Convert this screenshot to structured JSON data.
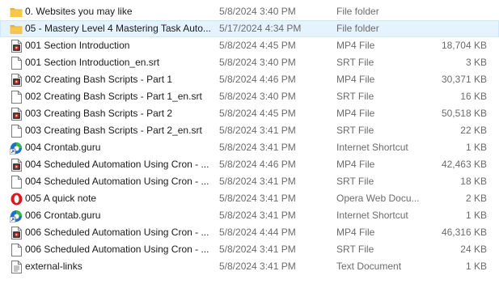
{
  "colors": {
    "selected_bg": "#e5f3ff",
    "folder": "#f5c74a",
    "media_icon_red": "#d42a1e",
    "edge_blue": "#1f6fd0",
    "edge_green": "#39b54a",
    "opera_red": "#e4141b"
  },
  "files": [
    {
      "name": "0. Websites you may like",
      "date": "5/8/2024 3:40 PM",
      "type": "File folder",
      "size": "",
      "icon": "folder-icon",
      "selected": false
    },
    {
      "name": "05 - Mastery Level 4 Mastering Task Auto...",
      "date": "5/17/2024 4:34 PM",
      "type": "File folder",
      "size": "",
      "icon": "folder-icon",
      "selected": true
    },
    {
      "name": "001 Section Introduction",
      "date": "5/8/2024 4:45 PM",
      "type": "MP4 File",
      "size": "18,704 KB",
      "icon": "video-file-icon",
      "selected": false
    },
    {
      "name": "001 Section Introduction_en.srt",
      "date": "5/8/2024 3:40 PM",
      "type": "SRT File",
      "size": "3 KB",
      "icon": "document-icon",
      "selected": false
    },
    {
      "name": "002 Creating Bash Scripts - Part 1",
      "date": "5/8/2024 4:46 PM",
      "type": "MP4 File",
      "size": "30,371 KB",
      "icon": "video-file-icon",
      "selected": false
    },
    {
      "name": "002 Creating Bash Scripts - Part 1_en.srt",
      "date": "5/8/2024 3:40 PM",
      "type": "SRT File",
      "size": "16 KB",
      "icon": "document-icon",
      "selected": false
    },
    {
      "name": "003 Creating Bash Scripts - Part 2",
      "date": "5/8/2024 4:45 PM",
      "type": "MP4 File",
      "size": "50,518 KB",
      "icon": "video-file-icon",
      "selected": false
    },
    {
      "name": "003 Creating Bash Scripts - Part 2_en.srt",
      "date": "5/8/2024 3:41 PM",
      "type": "SRT File",
      "size": "22 KB",
      "icon": "document-icon",
      "selected": false
    },
    {
      "name": "004 Crontab.guru",
      "date": "5/8/2024 3:41 PM",
      "type": "Internet Shortcut",
      "size": "1 KB",
      "icon": "edge-shortcut-icon",
      "selected": false
    },
    {
      "name": "004 Scheduled Automation Using Cron - ...",
      "date": "5/8/2024 4:46 PM",
      "type": "MP4 File",
      "size": "42,463 KB",
      "icon": "video-file-icon",
      "selected": false
    },
    {
      "name": "004 Scheduled Automation Using Cron - ...",
      "date": "5/8/2024 3:41 PM",
      "type": "SRT File",
      "size": "18 KB",
      "icon": "document-icon",
      "selected": false
    },
    {
      "name": "005 A quick note",
      "date": "5/8/2024 3:41 PM",
      "type": "Opera Web Docu...",
      "size": "2 KB",
      "icon": "opera-icon",
      "selected": false
    },
    {
      "name": "006 Crontab.guru",
      "date": "5/8/2024 3:41 PM",
      "type": "Internet Shortcut",
      "size": "1 KB",
      "icon": "edge-shortcut-icon",
      "selected": false
    },
    {
      "name": "006 Scheduled Automation Using Cron - ...",
      "date": "5/8/2024 4:44 PM",
      "type": "MP4 File",
      "size": "46,316 KB",
      "icon": "video-file-icon",
      "selected": false
    },
    {
      "name": "006 Scheduled Automation Using Cron - ...",
      "date": "5/8/2024 3:41 PM",
      "type": "SRT File",
      "size": "24 KB",
      "icon": "document-icon",
      "selected": false
    },
    {
      "name": "external-links",
      "date": "5/8/2024 3:41 PM",
      "type": "Text Document",
      "size": "1 KB",
      "icon": "text-document-icon",
      "selected": false
    }
  ]
}
